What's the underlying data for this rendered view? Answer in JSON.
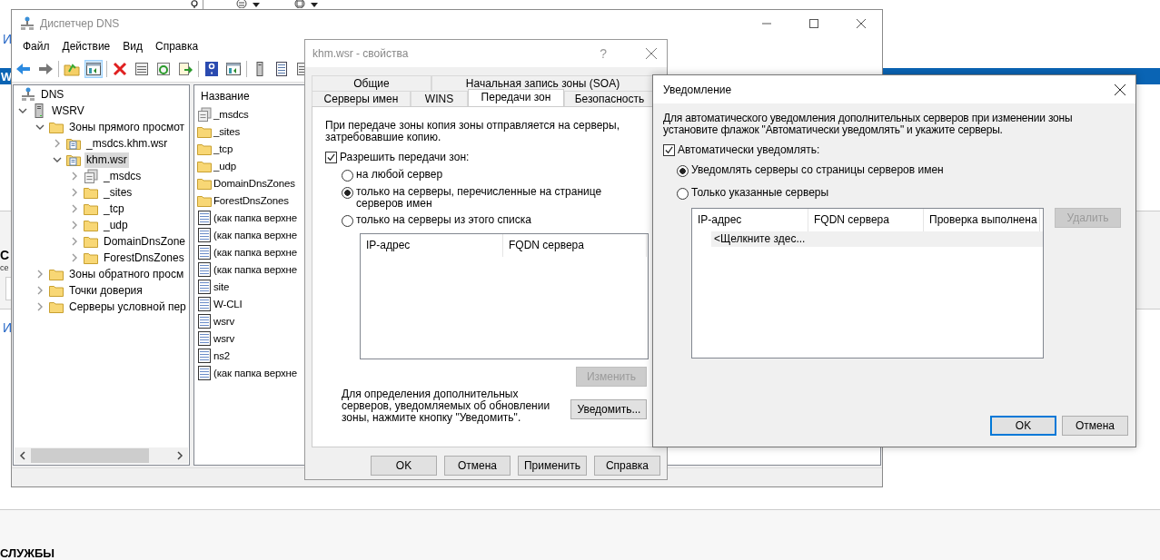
{
  "background": {
    "link_top": "И",
    "banner": "W",
    "heading": "С",
    "subtitle": "се",
    "link_bottom": "И",
    "section": "СЛУЖБЫ"
  },
  "dns_manager": {
    "title": "Диспетчер DNS",
    "menu": [
      "Файл",
      "Действие",
      "Вид",
      "Справка"
    ],
    "toolbar": [
      [
        {
          "kind": "back",
          "pressed": false
        },
        {
          "kind": "forward",
          "pressed": false
        }
      ],
      [
        {
          "kind": "up",
          "pressed": false
        },
        {
          "kind": "pane",
          "pressed": true
        }
      ],
      [
        {
          "kind": "delete",
          "pressed": false
        },
        {
          "kind": "properties",
          "pressed": false
        },
        {
          "kind": "refresh",
          "pressed": false
        },
        {
          "kind": "export",
          "pressed": false
        }
      ],
      [
        {
          "kind": "help",
          "pressed": false
        },
        {
          "kind": "pane",
          "pressed": false
        }
      ],
      [
        {
          "kind": "server",
          "pressed": false
        },
        {
          "kind": "list",
          "pressed": false
        },
        {
          "kind": "properties",
          "pressed": false
        }
      ]
    ],
    "tree": [
      {
        "label": "DNS",
        "kind": "dns",
        "selected": false,
        "children": [
          {
            "label": "WSRV",
            "kind": "server",
            "expanded": true,
            "selected": false,
            "children": [
              {
                "label": "Зоны прямого просмот",
                "kind": "folder",
                "expanded": true,
                "selected": false,
                "children": [
                  {
                    "label": "_msdcs.khm.wsr",
                    "kind": "zone",
                    "expanded": false,
                    "selected": false
                  },
                  {
                    "label": "khm.wsr",
                    "kind": "zone",
                    "expanded": true,
                    "selected": true,
                    "children": [
                      {
                        "label": "_msdcs",
                        "kind": "delegation",
                        "expanded": false,
                        "selected": false
                      },
                      {
                        "label": "_sites",
                        "kind": "folder",
                        "expanded": false,
                        "selected": false
                      },
                      {
                        "label": "_tcp",
                        "kind": "folder",
                        "expanded": false,
                        "selected": false
                      },
                      {
                        "label": "_udp",
                        "kind": "folder",
                        "expanded": false,
                        "selected": false
                      },
                      {
                        "label": "DomainDnsZone",
                        "kind": "folder",
                        "expanded": false,
                        "selected": false
                      },
                      {
                        "label": "ForestDnsZones",
                        "kind": "folder",
                        "expanded": false,
                        "selected": false
                      }
                    ]
                  }
                ]
              },
              {
                "label": "Зоны обратного просм",
                "kind": "folder",
                "expanded": false,
                "selected": false
              },
              {
                "label": "Точки доверия",
                "kind": "folder",
                "expanded": false,
                "selected": false
              },
              {
                "label": "Серверы условной пер",
                "kind": "folder",
                "expanded": false,
                "selected": false
              }
            ]
          }
        ]
      }
    ],
    "list": {
      "column": "Название",
      "items": [
        {
          "name": "_msdcs",
          "kind": "delegation"
        },
        {
          "name": "_sites",
          "kind": "folder"
        },
        {
          "name": "_tcp",
          "kind": "folder"
        },
        {
          "name": "_udp",
          "kind": "folder"
        },
        {
          "name": "DomainDnsZones",
          "kind": "folder"
        },
        {
          "name": "ForestDnsZones",
          "kind": "folder"
        },
        {
          "name": "(как папка верхне",
          "kind": "record"
        },
        {
          "name": "(как папка верхне",
          "kind": "record"
        },
        {
          "name": "(как папка верхне",
          "kind": "record"
        },
        {
          "name": "(как папка верхне",
          "kind": "record"
        },
        {
          "name": "site",
          "kind": "record"
        },
        {
          "name": "W-CLI",
          "kind": "record"
        },
        {
          "name": "wsrv",
          "kind": "record"
        },
        {
          "name": "wsrv",
          "kind": "record"
        },
        {
          "name": "ns2",
          "kind": "record"
        },
        {
          "name": "(как папка верхне",
          "kind": "record"
        }
      ]
    }
  },
  "properties": {
    "title": "khm.wsr - свойства",
    "help": "?",
    "tab_rows": [
      [
        {
          "label": "Общие",
          "selected": false
        },
        {
          "label": "Начальная запись зоны (SOA)",
          "selected": false
        }
      ],
      [
        {
          "label": "Серверы имен",
          "selected": false
        },
        {
          "label": "WINS",
          "selected": false
        },
        {
          "label": "Передачи зон",
          "selected": true
        },
        {
          "label": "Безопасность",
          "selected": false
        }
      ]
    ],
    "description": "При передаче зоны копия зоны отправляется на серверы, затребовавшие копию.",
    "allow": {
      "label": "Разрешить передачи зон:",
      "checked": true
    },
    "options": [
      {
        "label": "на любой сервер",
        "selected": false
      },
      {
        "label": "только на серверы, перечисленные на странице серверов имен",
        "selected": true
      },
      {
        "label": "только на серверы из этого списка",
        "selected": false
      }
    ],
    "columns": [
      "IP-адрес",
      "FQDN сервера"
    ],
    "edit_button": {
      "label": "Изменить",
      "disabled": true
    },
    "note": "Для определения дополнительных серверов, уведомляемых об обновлении зоны, нажмите кнопку \"Уведомить\".",
    "notify_button": {
      "label": "Уведомить...",
      "disabled": false
    },
    "buttons": [
      {
        "label": "OK",
        "disabled": false
      },
      {
        "label": "Отмена",
        "disabled": false
      },
      {
        "label": "Применить",
        "disabled": false
      },
      {
        "label": "Справка",
        "disabled": false
      }
    ]
  },
  "notify": {
    "title": "Уведомление",
    "description": "Для автоматического уведомления дополнительных серверов при изменении зоны установите флажок \"Автоматически уведомлять\" и укажите серверы.",
    "auto": {
      "label": "Автоматически уведомлять:",
      "checked": true
    },
    "options": [
      {
        "label": "Уведомлять серверы со страницы серверов имен",
        "selected": true
      },
      {
        "label": "Только указанные серверы",
        "selected": false
      }
    ],
    "columns": [
      "IP-адрес",
      "FQDN сервера",
      "Проверка выполнена"
    ],
    "new_row": "<Щелкните здес...",
    "remove_button": {
      "label": "Удалить",
      "disabled": true
    },
    "buttons": [
      {
        "label": "OK",
        "default": true
      },
      {
        "label": "Отмена",
        "default": false
      }
    ]
  }
}
